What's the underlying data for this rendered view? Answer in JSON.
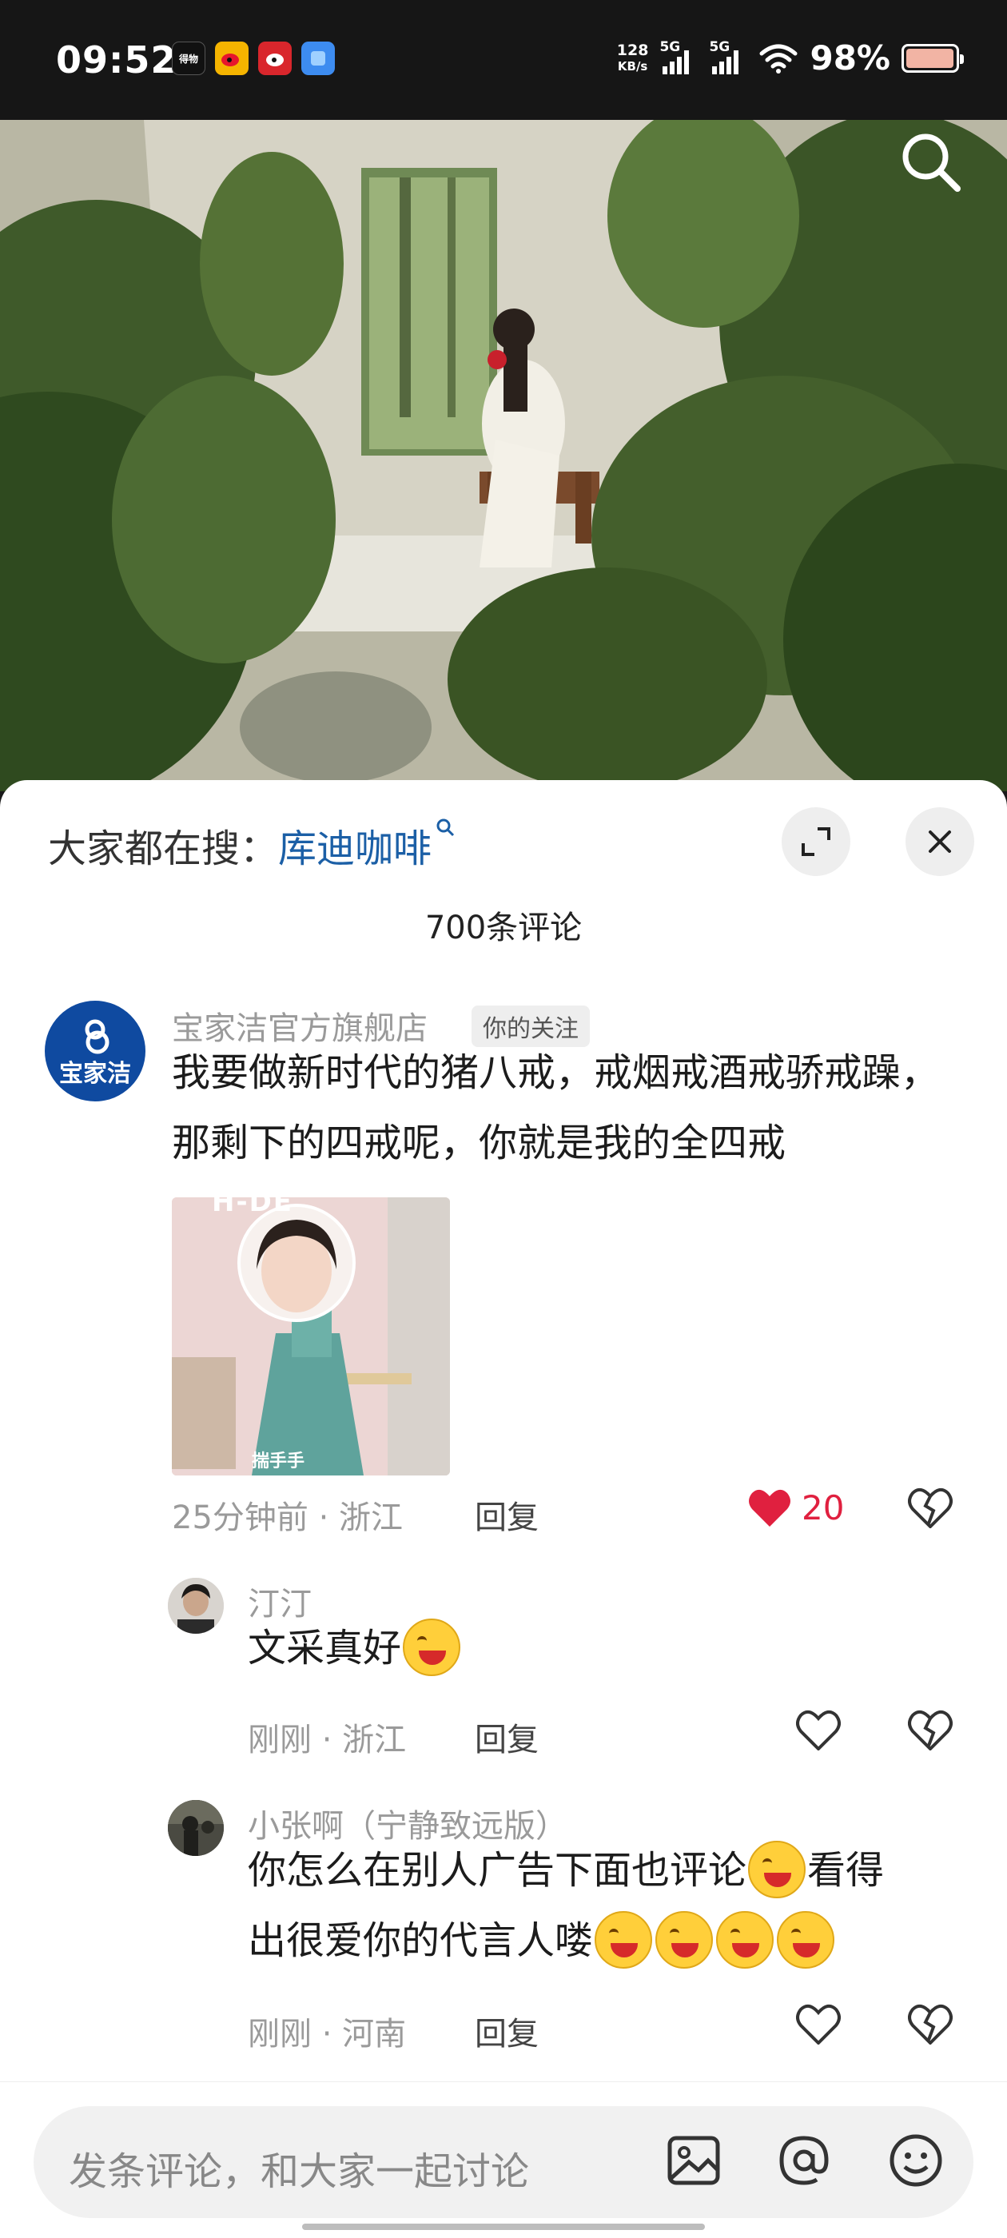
{
  "status_bar": {
    "time": "09:52",
    "net_speed_value": "128",
    "net_speed_unit": "KB/s",
    "signal1_label": "5G",
    "signal2_label": "5G",
    "battery_percent": "98%",
    "battery_level": 0.98,
    "notification_icons": [
      "dewu-icon",
      "weibo-icon",
      "weibo-red-icon",
      "app-icon"
    ]
  },
  "search": {
    "prefix": "大家都在搜：",
    "keyword": "库迪咖啡"
  },
  "comments_count": "700条评论",
  "main_comment": {
    "user": "宝家洁官方旗舰店",
    "avatar_text": "宝家洁",
    "tag": "你的关注",
    "text_line1": "我要做新时代的猪八戒，戒烟戒酒戒骄戒躁，",
    "text_line2": "那剩下的四戒呢，你就是我的全四戒",
    "sticker_caption": "揣手手",
    "sticker_banner": "H-DE",
    "time": "25分钟前 · 浙江",
    "reply": "回复",
    "likes": "20"
  },
  "replies": [
    {
      "user": "汀汀",
      "text": "文采真好",
      "time": "刚刚 · 浙江",
      "reply": "回复"
    },
    {
      "user": "小张啊（宁静致远版）",
      "text_line1_a": "你怎么在别人广告下面也评论",
      "text_line1_b": "看得",
      "text_line2": "出很爱你的代言人喽",
      "time": "刚刚 · 河南",
      "reply": "回复"
    }
  ],
  "input": {
    "placeholder": "发条评论，和大家一起讨论"
  },
  "colors": {
    "accent_blue": "#1b5fa6",
    "like_red": "#e0203f",
    "brand_blue": "#0f4aa0"
  }
}
